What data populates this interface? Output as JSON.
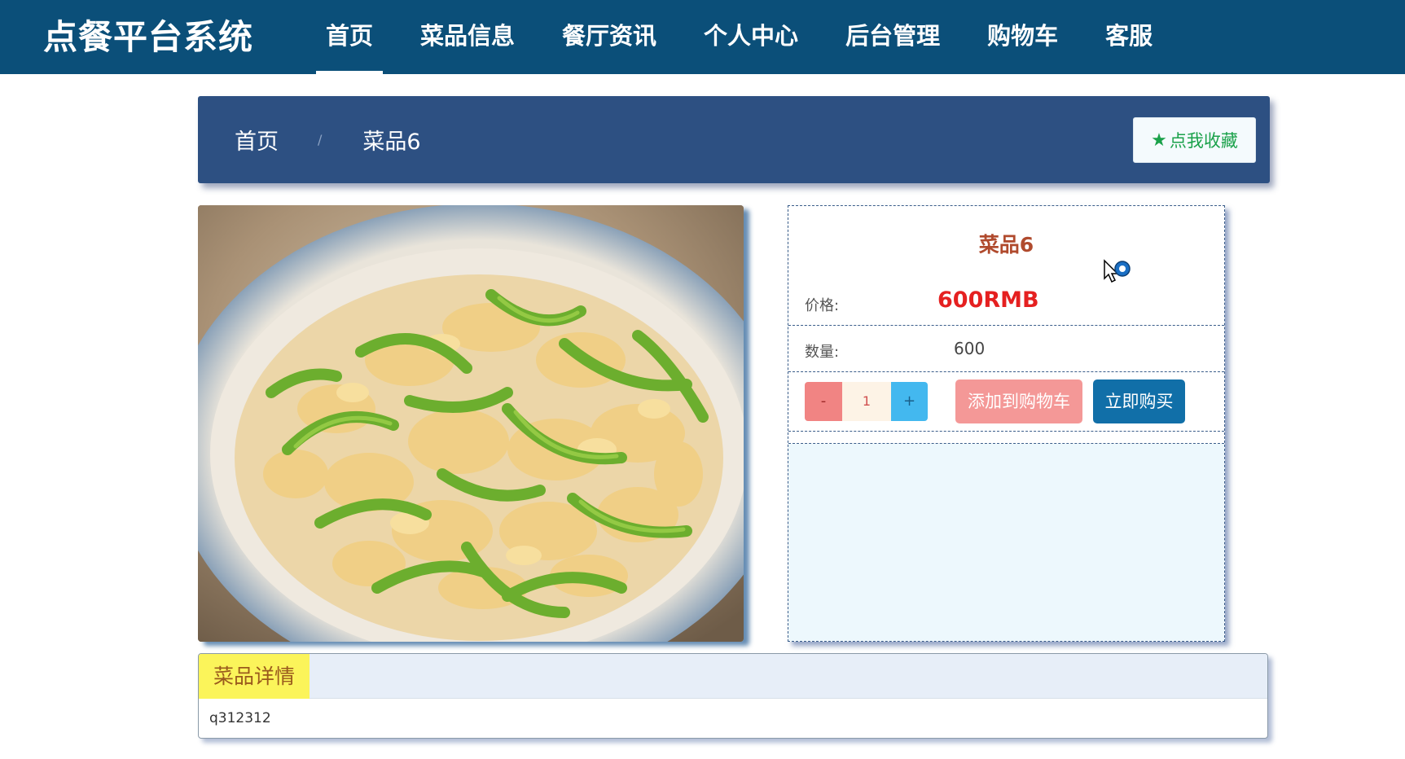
{
  "header": {
    "brand": "点餐平台系统",
    "nav": [
      "首页",
      "菜品信息",
      "餐厅资讯",
      "个人中心",
      "后台管理",
      "购物车",
      "客服"
    ],
    "active_index": 0
  },
  "breadcrumb": {
    "home": "首页",
    "separator": "/",
    "current": "菜品6",
    "favorite_label": "点我收藏",
    "favorite_icon": "star-icon"
  },
  "product": {
    "title": "菜品6",
    "price_label": "价格:",
    "price": "600RMB",
    "quantity_label": "数量:",
    "quantity": "600",
    "stepper": {
      "minus": "-",
      "value": "1",
      "plus": "+"
    },
    "add_to_cart": "添加到购物车",
    "buy_now": "立即购买"
  },
  "details": {
    "tab_label": "菜品详情",
    "content": "q312312"
  },
  "colors": {
    "nav_bg": "#0b4f79",
    "crumb_bg": "#2d5082",
    "price": "#e52020",
    "cart_btn": "#f49897",
    "buy_btn": "#116fa8"
  }
}
